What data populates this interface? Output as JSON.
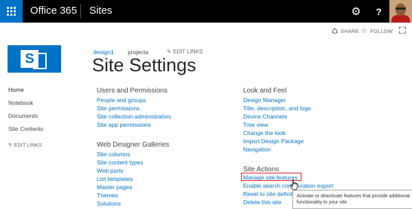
{
  "topbar": {
    "brand": "Office 365",
    "suite": "Sites",
    "help_label": "?"
  },
  "page_actions": {
    "share_label": "SHARE",
    "follow_label": "FOLLOW"
  },
  "breadcrumb": {
    "site": "design1",
    "subsite": "projecta",
    "edit_links_label": "EDIT LINKS"
  },
  "page": {
    "title": "Site Settings"
  },
  "leftnav": {
    "items": [
      {
        "label": "Home",
        "active": true
      },
      {
        "label": "Notebook",
        "active": false
      },
      {
        "label": "Documents",
        "active": false
      },
      {
        "label": "Site Contents",
        "active": false
      }
    ],
    "edit_links_label": "EDIT LINKS"
  },
  "sections": {
    "users": {
      "title": "Users and Permissions",
      "links": [
        "People and groups",
        "Site permissions",
        "Site collection administrators",
        "Site app permissions"
      ]
    },
    "galleries": {
      "title": "Web Designer Galleries",
      "links": [
        "Site columns",
        "Site content types",
        "Web parts",
        "List templates",
        "Master pages",
        "Themes",
        "Solutions"
      ]
    },
    "look": {
      "title": "Look and Feel",
      "links": [
        "Design Manager",
        "Title, description, and logo",
        "Device Channels",
        "Tree view",
        "Change the look",
        "Import Design Package",
        "Navigation"
      ]
    },
    "actions": {
      "title": "Site Actions",
      "links": [
        "Manage site features",
        "Enable search configuration export",
        "Reset to site definition",
        "Delete this site"
      ]
    }
  },
  "tooltip": {
    "text": "Activate or deactivate features that provide additional functionality to your site."
  },
  "colors": {
    "accent": "#0072c6",
    "topbar": "#000000",
    "highlight": "#e81123"
  }
}
